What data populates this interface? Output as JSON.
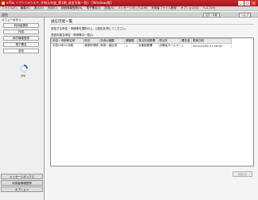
{
  "window": {
    "title": "e-Tax ソフト(ヨウスケ_令和元年度_第1期_送信可能一覧) - [Windows版]",
    "minimize": "_",
    "maximize": "□",
    "close": "×"
  },
  "menubar": {
    "items": [
      "ファイル(F)",
      "編集(E)",
      "表示(V)",
      "作成(C)",
      "納税情報登録(N)",
      "電子署名(I)",
      "送信(S)",
      "メッセージボックス(M)",
      "利用者ファイル登録",
      "オプション(O)",
      "ヘルプ(H)"
    ]
  },
  "sectionbar": {
    "label": "送信",
    "print_button": "表示 / 印刷",
    "help_button": "ヘルプ"
  },
  "sidebar": {
    "header": "メニューボタン",
    "nav": [
      "利用者選択",
      "作成",
      "納付情報登録",
      "電子署名",
      "送信"
    ],
    "busy_label": "送信",
    "bottom": [
      "メッセージボックス",
      "利用者情報登録",
      "オプション"
    ]
  },
  "main": {
    "page_title": "送信可能一覧",
    "instruction": "送信する申告・申請等を選択の上、[送信]を押してください。",
    "list_label": "送信可能な申告・申請等の一覧(J)",
    "table": {
      "columns": [
        "申告・申請等名称",
        "税目",
        "手続の種類",
        "種類数",
        "提出先税務署",
        "提出先",
        "署名者",
        "更新日時"
      ],
      "rows": [
        [
          "平成24年11月期",
          "源泉所得税",
          "申請・届出書",
          "1",
          "京都税務署",
          "法務省ホームページ",
          "1",
          "2012/12/05 11:16:00"
        ]
      ]
    },
    "send_button": "送信(S)"
  }
}
